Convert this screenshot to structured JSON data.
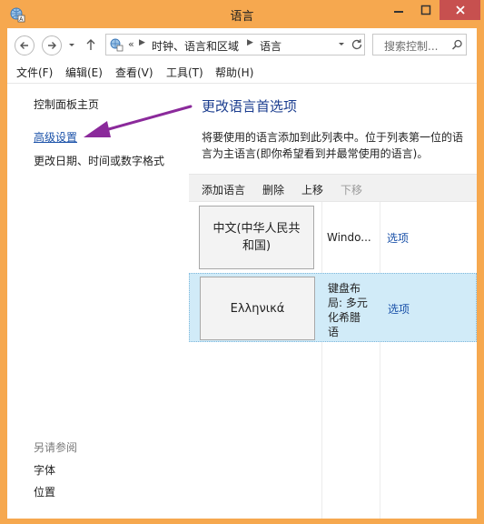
{
  "window": {
    "title": "语言"
  },
  "address": {
    "more": "«",
    "crumbs": [
      "时钟、语言和区域",
      "语言"
    ]
  },
  "search": {
    "placeholder": "搜索控制..."
  },
  "menu": [
    "文件(F)",
    "编辑(E)",
    "查看(V)",
    "工具(T)",
    "帮助(H)"
  ],
  "sidebar": {
    "home": "控制面板主页",
    "advanced": "高级设置",
    "datetime": "更改日期、时间或数字格式",
    "see_also": "另请参阅",
    "fonts": "字体",
    "location": "位置"
  },
  "main": {
    "title": "更改语言首选项",
    "description": "将要使用的语言添加到此列表中。位于列表第一位的语言为主语言(即你希望看到并最常使用的语言)。"
  },
  "toolbar": {
    "add": "添加语言",
    "remove": "删除",
    "up": "上移",
    "down": "下移"
  },
  "languages": [
    {
      "name_line1": "中文(中华人民共",
      "name_line2": "和国)",
      "layout_lines": [
        "Windo..."
      ],
      "options": "选项",
      "selected": false
    },
    {
      "name_line1": "Ελληνικά",
      "name_line2": "",
      "layout_lines": [
        "键盘布",
        "局: 多元",
        "化希腊",
        "语"
      ],
      "options": "选项",
      "selected": true
    }
  ],
  "colors": {
    "frame": "#f6a84f",
    "close": "#c7504f",
    "link": "#1b52a9",
    "title": "#1b3d8f",
    "selection": "#d1ebf8",
    "annotation_arrow": "#8b2a9b"
  }
}
